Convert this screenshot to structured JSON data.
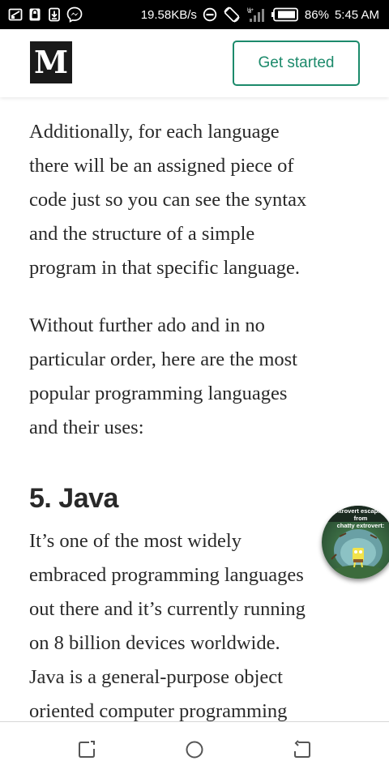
{
  "status_bar": {
    "network_speed": "19.58KB/s",
    "battery": "86%",
    "time": "5:45 AM",
    "icons": [
      "cast-icon",
      "lock-icon",
      "download-icon",
      "messenger-icon",
      "do-not-disturb-icon",
      "auto-rotate-icon",
      "signal-icon",
      "battery-icon"
    ]
  },
  "header": {
    "logo_letter": "M",
    "cta_label": "Get started",
    "accent_color": "#1c8a6b"
  },
  "article": {
    "paragraph_1_lines": [
      "Additionally, for each language",
      "there will be an assigned piece of",
      "code just so you can see the syntax",
      "and the structure of a simple",
      "program in that specific language."
    ],
    "paragraph_2_lines": [
      "Without further ado and in no",
      "particular order, here are the most",
      "popular programming languages",
      "and their uses:"
    ],
    "section_heading": "5. Java",
    "paragraph_3_lines": [
      "It’s one of the most widely",
      "embraced programming languages",
      "out there and it’s currently running",
      "on 8 billion devices worldwide.",
      "Java is a general-purpose object",
      "oriented computer programming"
    ]
  },
  "floating_bubble": {
    "caption_line_1": "Introvert escaping from",
    "caption_line_2": "chatty extrovert:"
  },
  "nav_bar": {
    "icons": [
      "recent-apps-icon",
      "home-icon",
      "back-icon"
    ]
  }
}
